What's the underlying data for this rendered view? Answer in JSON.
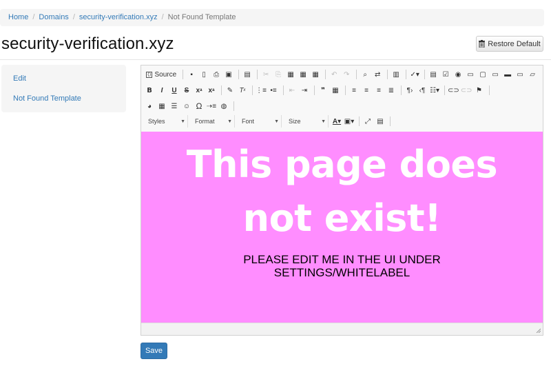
{
  "breadcrumb": {
    "items": [
      "Home",
      "Domains",
      "security-verification.xyz"
    ],
    "current": "Not Found Template",
    "separator": "/"
  },
  "page": {
    "title": "security-verification.xyz",
    "restore_label": "Restore Default",
    "save_label": "Save"
  },
  "sidebar": {
    "items": [
      "Edit",
      "Not Found Template"
    ]
  },
  "editor": {
    "toolbar": {
      "source_label": "Source",
      "styles_label": "Styles",
      "format_label": "Format",
      "font_label": "Font",
      "size_label": "Size"
    },
    "content": {
      "headline_line1": "This page does",
      "headline_line2": "not exist!",
      "note_line1": "PLEASE EDIT ME IN THE UI UNDER",
      "note_line2": "SETTINGS/WHITELABEL",
      "background_color": "#ff8dff"
    }
  },
  "colors": {
    "link": "#337ab7",
    "primary_button": "#337ab7"
  }
}
